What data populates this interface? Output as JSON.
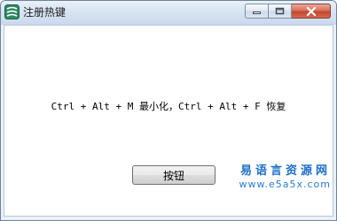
{
  "window": {
    "title": "注册热键"
  },
  "content": {
    "hotkey_text": "Ctrl + Alt + M 最小化，Ctrl + Alt + F 恢复",
    "button_label": "按钮"
  },
  "watermark": {
    "title": "易语言资源网",
    "url": "www.e5a5x.com"
  },
  "icons": {
    "app": "app-icon",
    "minimize": "minimize-icon",
    "maximize": "maximize-icon",
    "close": "close-icon"
  },
  "colors": {
    "accent": "#1d6fc9",
    "close_button": "#c6452e",
    "title_bar": "#d7e4f2"
  }
}
